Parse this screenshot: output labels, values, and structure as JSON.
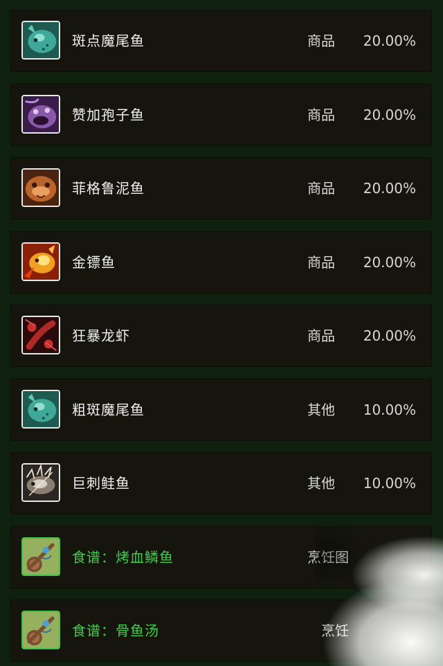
{
  "items": [
    {
      "name": "斑点魔尾鱼",
      "type": "商品",
      "chance": "20.00%",
      "icon": "spotted-fish-icon",
      "recipe": false
    },
    {
      "name": "赞加孢子鱼",
      "type": "商品",
      "chance": "20.00%",
      "icon": "spore-fish-icon",
      "recipe": false
    },
    {
      "name": "菲格鲁泥鱼",
      "type": "商品",
      "chance": "20.00%",
      "icon": "mud-fish-icon",
      "recipe": false
    },
    {
      "name": "金镖鱼",
      "type": "商品",
      "chance": "20.00%",
      "icon": "golden-darter-icon",
      "recipe": false
    },
    {
      "name": "狂暴龙虾",
      "type": "商品",
      "chance": "20.00%",
      "icon": "lobster-icon",
      "recipe": false
    },
    {
      "name": "粗斑魔尾鱼",
      "type": "其他",
      "chance": "10.00%",
      "icon": "spotted-fish-icon",
      "recipe": false
    },
    {
      "name": "巨刺鲑鱼",
      "type": "其他",
      "chance": "10.00%",
      "icon": "spined-fish-icon",
      "recipe": false
    },
    {
      "name": "食谱：烤血鳞鱼",
      "type": "烹饪图",
      "chance": "",
      "icon": "recipe-scroll-icon",
      "recipe": true
    },
    {
      "name": "食谱：骨鱼汤",
      "type": "烹饪",
      "chance": "",
      "icon": "recipe-scroll-icon",
      "recipe": true
    }
  ],
  "colors": {
    "recipe_text": "#3fcf4a",
    "recipe_border": "#3fc447",
    "row_bg": "#15150e",
    "page_bg": "#10200f"
  }
}
